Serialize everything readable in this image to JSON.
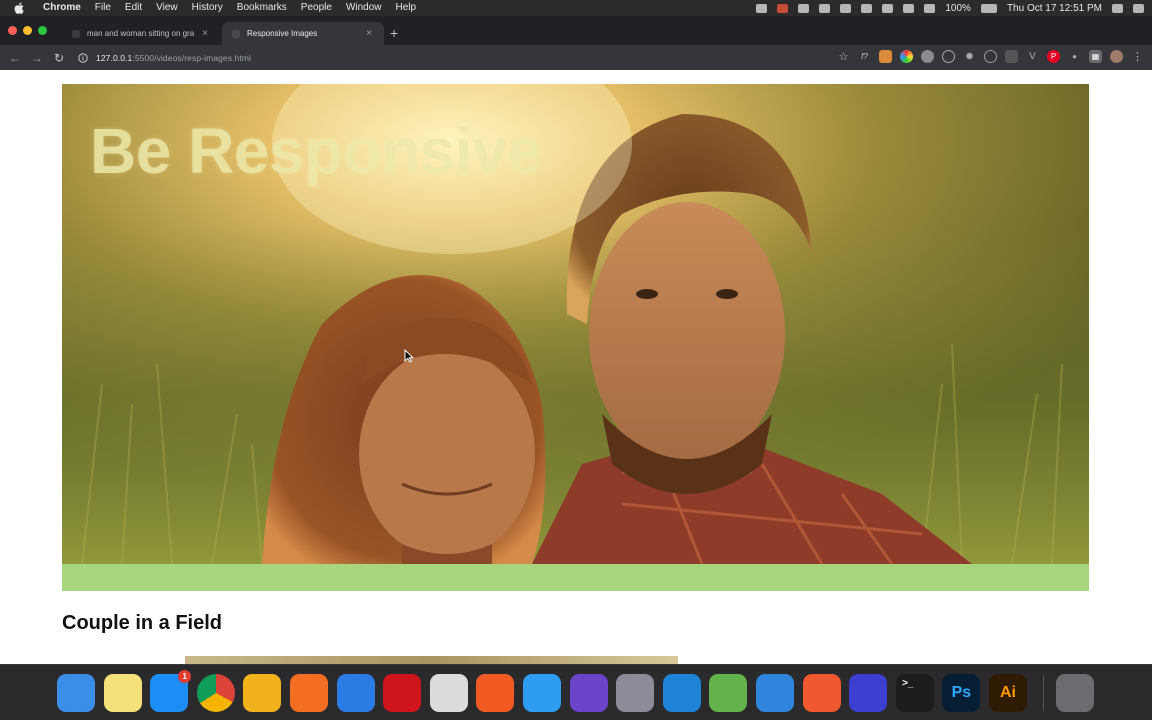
{
  "menubar": {
    "app_name": "Chrome",
    "items": [
      "File",
      "Edit",
      "View",
      "History",
      "Bookmarks",
      "People",
      "Window",
      "Help"
    ],
    "battery": "100%",
    "clock": "Thu Oct 17  12:51 PM"
  },
  "tabs": [
    {
      "title": "man and woman sitting on gra",
      "close": "×"
    },
    {
      "title": "Responsive Images",
      "close": "×"
    }
  ],
  "new_tab_label": "+",
  "toolbar": {
    "url_host": "127.0.0.1",
    "url_rest": ":5500/videos/resp-images.html"
  },
  "page": {
    "hero_title": "Be Responsive",
    "section_title": "Couple in a Field"
  },
  "dock": {
    "items": [
      {
        "name": "finder-icon",
        "color": "#3b8ee8"
      },
      {
        "name": "notes-icon",
        "color": "#f3e17a"
      },
      {
        "name": "app-store-icon",
        "color": "#1c8df5",
        "badge": "1"
      },
      {
        "name": "chrome-icon",
        "color": "#e8e8e8"
      },
      {
        "name": "chrome-canary-icon",
        "color": "#f2b21c"
      },
      {
        "name": "firefox-icon",
        "color": "#f36d23"
      },
      {
        "name": "firefox-dev-icon",
        "color": "#2a7be4"
      },
      {
        "name": "opera-icon",
        "color": "#d0141c"
      },
      {
        "name": "opera-gx-icon",
        "color": "#dcdcdc"
      },
      {
        "name": "brave-icon",
        "color": "#f25a24"
      },
      {
        "name": "safari-icon",
        "color": "#2e9cf0"
      },
      {
        "name": "safari-tech-preview-icon",
        "color": "#6a44c9"
      },
      {
        "name": "motion-icon",
        "color": "#8b8b9a"
      },
      {
        "name": "vscode-icon",
        "color": "#1f84d8"
      },
      {
        "name": "android-studio-icon",
        "color": "#62b34b"
      },
      {
        "name": "xcode-icon",
        "color": "#2f86dc"
      },
      {
        "name": "swift-icon",
        "color": "#f0582f"
      },
      {
        "name": "polypane-icon",
        "color": "#3c3fd1"
      },
      {
        "name": "terminal-icon",
        "color": "#1c1c1c",
        "label": ">_"
      },
      {
        "name": "photoshop-icon",
        "color": "#061e33",
        "label": "Ps"
      },
      {
        "name": "illustrator-icon",
        "color": "#2f1a04",
        "label": "Ai"
      },
      {
        "name": "trash-icon",
        "color": "#6c6c70"
      }
    ]
  }
}
